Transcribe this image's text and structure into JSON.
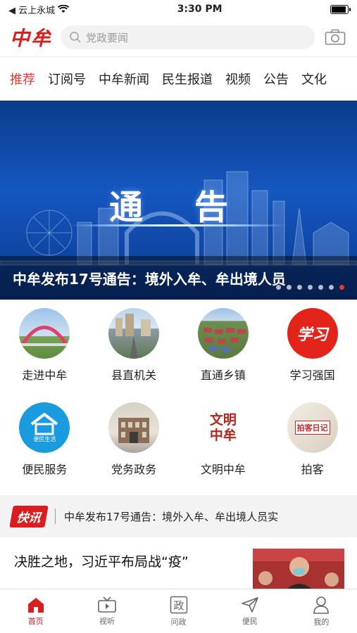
{
  "status_bar": {
    "carrier": "◀ 云上永城",
    "time": "3:30 PM"
  },
  "header": {
    "logo": "中牟",
    "search_placeholder": "党政要闻"
  },
  "tabs": [
    "推荐",
    "订阅号",
    "中牟新闻",
    "民生报道",
    "视频",
    "公告",
    "文化"
  ],
  "banner": {
    "heading": "通 告",
    "caption": "中牟发布17号通告：境外入牟、牟出境人员",
    "slide_count": 7,
    "active_slide": 6
  },
  "shortcuts": [
    {
      "label": "走进中牟",
      "icon": "arch-bridge-photo"
    },
    {
      "label": "县直机关",
      "icon": "city-road-photo"
    },
    {
      "label": "直通乡镇",
      "icon": "town-aerial-photo"
    },
    {
      "label": "学习强国",
      "icon": "xuexi-logo",
      "badge_text": "学习"
    },
    {
      "label": "便民服务",
      "icon": "house-logo",
      "badge_text": "便民生活"
    },
    {
      "label": "党务政务",
      "icon": "government-building-photo"
    },
    {
      "label": "文明中牟",
      "icon": "civilization-logo",
      "badge_text": "文明\n中牟"
    },
    {
      "label": "拍客",
      "icon": "paike-logo",
      "badge_text": "拍客日记"
    }
  ],
  "flash": {
    "badge": "快讯",
    "text": "中牟发布17号通告：境外入牟、牟出境人员实"
  },
  "news": [
    {
      "title": "决胜之地，习近平布局战“疫”"
    }
  ],
  "bottom_nav": [
    {
      "label": "首页",
      "icon": "home-icon",
      "active": true
    },
    {
      "label": "视听",
      "icon": "tv-icon",
      "active": false
    },
    {
      "label": "问政",
      "icon": "zheng-icon",
      "active": false
    },
    {
      "label": "便民",
      "icon": "send-icon",
      "active": false
    },
    {
      "label": "我的",
      "icon": "user-icon",
      "active": false
    }
  ],
  "colors": {
    "brand_red": "#d81e1e",
    "tab_active": "#e53935",
    "banner_blue": "#1557c0"
  }
}
